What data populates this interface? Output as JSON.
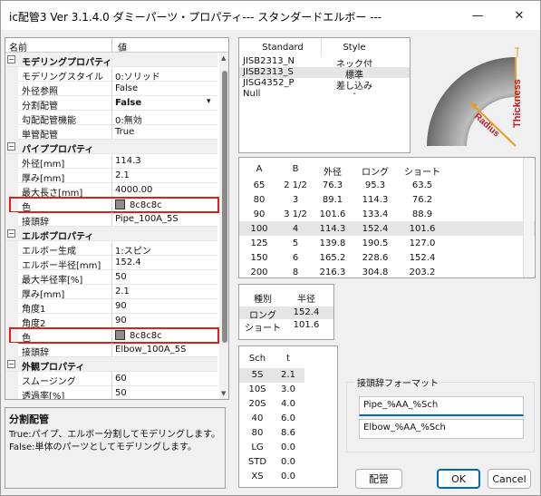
{
  "window": {
    "title": "ic配管3 Ver 3.1.4.0 ダミーパーツ・プロパティ--- スタンダードエルボー ---"
  },
  "grid": {
    "header": {
      "name": "名前",
      "value": "値"
    },
    "rows": [
      {
        "type": "cat",
        "name": "モデリングプロパティ"
      },
      {
        "name": "モデリングスタイル",
        "value": "0:ソリッド"
      },
      {
        "name": "外径参照",
        "value": "False"
      },
      {
        "name": "分割配管",
        "value": "False",
        "bold": true
      },
      {
        "name": "勾配配管機能",
        "value": "0:無効"
      },
      {
        "name": "単管配管",
        "value": "True"
      },
      {
        "type": "cat",
        "name": "パイププロパティ"
      },
      {
        "name": "外径[mm]",
        "value": "114.3"
      },
      {
        "name": "厚み[mm]",
        "value": "2.1"
      },
      {
        "name": "最大長さ[mm]",
        "value": "4000.00"
      },
      {
        "name": "色",
        "value": "8c8c8c",
        "color": "#8c8c8c"
      },
      {
        "name": "接頭辞",
        "value": "Pipe_100A_5S"
      },
      {
        "type": "cat",
        "name": "エルボプロパティ"
      },
      {
        "name": "エルボー生成",
        "value": "1:スピン"
      },
      {
        "name": "エルボー半径[mm]",
        "value": "152.4"
      },
      {
        "name": "最大半径率[%]",
        "value": "50"
      },
      {
        "name": "厚み[mm]",
        "value": "2.1"
      },
      {
        "name": "角度1",
        "value": "90"
      },
      {
        "name": "角度2",
        "value": "90"
      },
      {
        "name": "色",
        "value": "8c8c8c",
        "color": "#8c8c8c"
      },
      {
        "name": "接頭辞",
        "value": "Elbow_100A_5S"
      },
      {
        "type": "cat",
        "name": "外観プロパティ"
      },
      {
        "name": "スムージング",
        "value": "60"
      },
      {
        "name": "透過率[%]",
        "value": "50"
      }
    ]
  },
  "description": {
    "title": "分割配管",
    "line1": "True:パイプ、エルボー分割してモデリングします。",
    "line2": "False:単体のパーツとしてモデリングします。"
  },
  "standards": {
    "header": {
      "standard": "Standard",
      "style": "Style"
    },
    "rows": [
      {
        "standard": "JISB2313_N",
        "style": "ネック付"
      },
      {
        "standard": "JISB2313_S",
        "style": "標準"
      },
      {
        "standard": "JISG4352_P",
        "style": "差し込み"
      },
      {
        "standard": "Null",
        "style": "-"
      }
    ]
  },
  "diagram": {
    "thickness": "Thickness",
    "radius": "Radius"
  },
  "sizes": {
    "headers": [
      "A",
      "B",
      "外径",
      "ロング",
      "ショート"
    ],
    "rows": [
      [
        "65",
        "2 1/2",
        "76.3",
        "95.3",
        "63.5"
      ],
      [
        "80",
        "3",
        "89.1",
        "114.3",
        "76.2"
      ],
      [
        "90",
        "3 1/2",
        "101.6",
        "133.4",
        "88.9"
      ],
      [
        "100",
        "4",
        "114.3",
        "152.4",
        "101.6"
      ],
      [
        "125",
        "5",
        "139.8",
        "190.5",
        "127.0"
      ],
      [
        "150",
        "6",
        "165.2",
        "228.6",
        "152.4"
      ],
      [
        "200",
        "8",
        "216.3",
        "304.8",
        "203.2"
      ]
    ]
  },
  "radius": {
    "headers": [
      "種別",
      "半径"
    ],
    "rows": [
      [
        "ロング",
        "152.4"
      ],
      [
        "ショート",
        "101.6"
      ]
    ]
  },
  "schedule": {
    "headers": [
      "Sch",
      "t"
    ],
    "rows": [
      [
        "5S",
        "2.1"
      ],
      [
        "10S",
        "3.0"
      ],
      [
        "20S",
        "4.0"
      ],
      [
        "40",
        "6.0"
      ],
      [
        "80",
        "8.6"
      ],
      [
        "LG",
        "0.0"
      ],
      [
        "STD",
        "0.0"
      ],
      [
        "XS",
        "0.0"
      ]
    ]
  },
  "prefix": {
    "label": "接頭辞フォーマット",
    "pipe": "Pipe_%AA_%Sch",
    "elbow": "Elbow_%AA_%Sch"
  },
  "buttons": {
    "piping": "配管",
    "ok": "OK",
    "cancel": "Cancel"
  },
  "colors": {
    "highlight": "#e0201a",
    "selected": "#e5e5e5",
    "accent": "#0067c0",
    "pipe": "#8c8c8c"
  },
  "icons": [
    "app-icon",
    "minimize-icon",
    "close-icon",
    "dropdown-arrow-icon",
    "scroll-up-icon",
    "scroll-down-icon"
  ]
}
